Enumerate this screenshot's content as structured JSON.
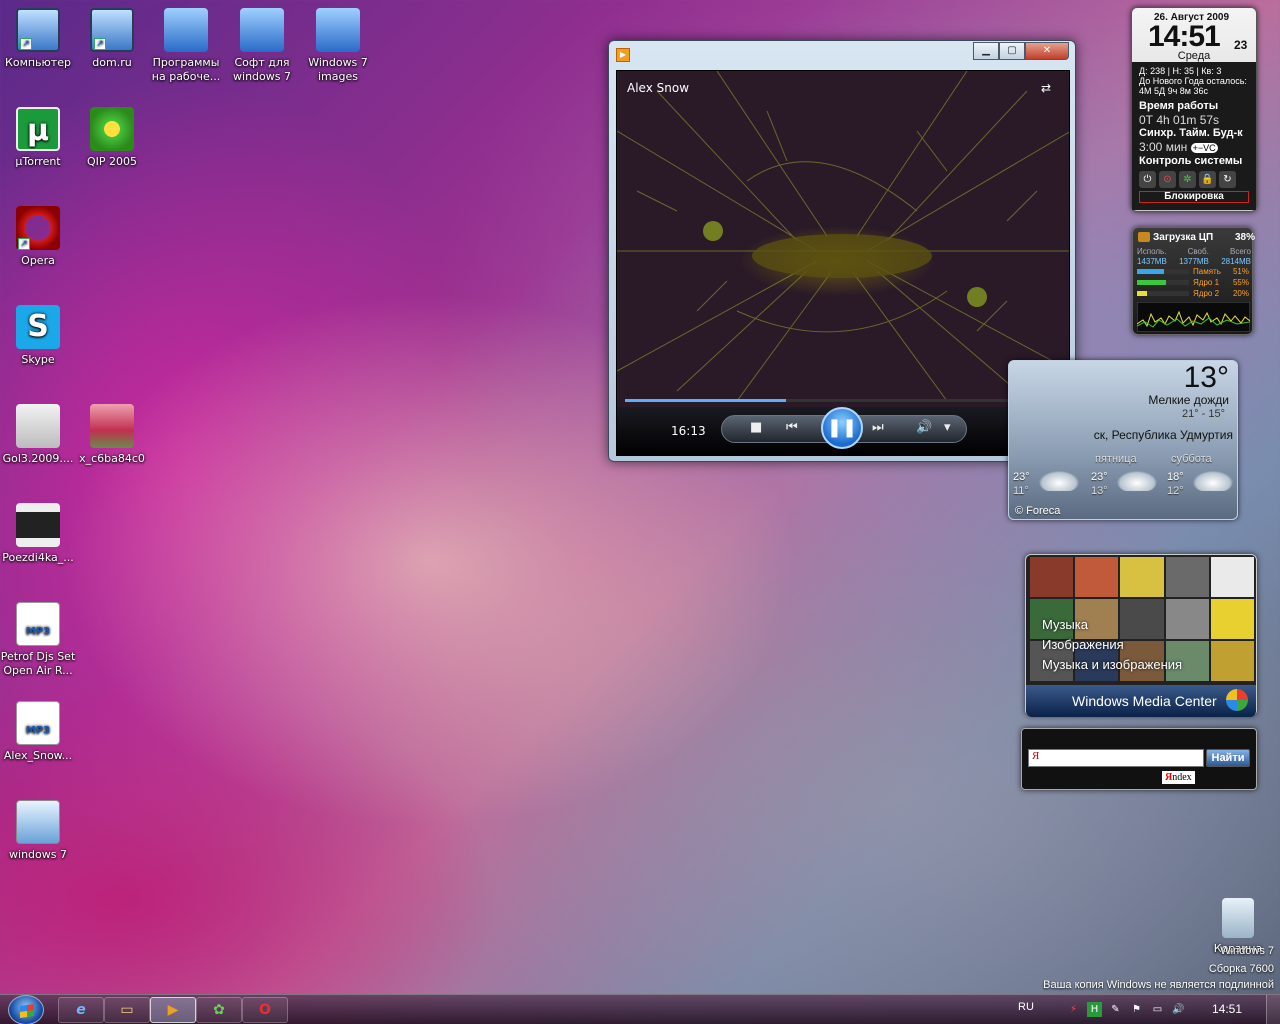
{
  "desktop_icons": [
    {
      "label": "Компьютер",
      "icon": "computer-icon"
    },
    {
      "label": "dom.ru",
      "icon": "computer-icon"
    },
    {
      "label": "Программы на рабоче...",
      "icon": "folder-icon"
    },
    {
      "label": "Софт для windows 7",
      "icon": "folder-icon"
    },
    {
      "label": "Windows 7 images",
      "icon": "folder-icon"
    },
    {
      "label": "µTorrent",
      "icon": "utorrent-icon"
    },
    {
      "label": "QIP 2005",
      "icon": "qip-icon"
    },
    {
      "label": "Opera",
      "icon": "opera-icon"
    },
    {
      "label": "Skype",
      "icon": "skype-icon"
    },
    {
      "label": "Gol3.2009....",
      "icon": "video-file-icon"
    },
    {
      "label": "x_c6ba84c0",
      "icon": "photo-icon"
    },
    {
      "label": "Poezdi4ka_...",
      "icon": "video-file-icon"
    },
    {
      "label": "Petrof Djs Set Open Air R...",
      "icon": "mp3-file-icon"
    },
    {
      "label": "Alex_Snow...",
      "icon": "mp3-file-icon"
    },
    {
      "label": "windows 7",
      "icon": "screenshot-icon"
    },
    {
      "label": "Корзина",
      "icon": "recycle-bin-icon"
    }
  ],
  "icon_glyphs": {
    "mp3": "MP3",
    "utorrent": "µ",
    "skype": "S",
    "shortcut": "↗"
  },
  "media_player": {
    "track": "Alex Snow",
    "time": "16:13",
    "progress": 0.37,
    "buttons": {
      "minimize": "▁",
      "maximize": "▢",
      "close": "✕",
      "stop": "■",
      "prev": "⏮",
      "pause": "❚❚",
      "next": "⏭",
      "volume": "🔊",
      "volume_menu": "▾",
      "switch_view": "⇄",
      "fullscreen": "⤢"
    },
    "icon": "▶"
  },
  "clock_gadget": {
    "date": "26. Август 2009",
    "hm": "14:51",
    "seconds": "23",
    "weekday": "Среда",
    "line1": "Д: 238 | Н: 35 | Кв: 3",
    "line2": "До Нового Года осталось:",
    "line3": "4М 5Д 9ч 8м 36с",
    "uptime_label": "Время работы",
    "uptime": "0Т 4h 01m 57s",
    "timer_label": "Синхр. Тайм. Буд-к",
    "timer": "3:00 мин",
    "timer_ctrl": "+−VC",
    "control_label": "Контроль системы",
    "system_buttons": [
      "⏻",
      "⊙",
      "✲",
      "🔒",
      "↻"
    ],
    "lock_label": "Блокировка"
  },
  "cpu_gadget": {
    "title": "Загрузка ЦП",
    "load": "38%",
    "cols": [
      "Исполь.",
      "Своб.",
      "Всего"
    ],
    "values": [
      "1437MB",
      "1377MB",
      "2814MB"
    ],
    "rows": [
      {
        "label": "Память",
        "pct": "51%",
        "fill": 0.51,
        "color": "#3aa8e8"
      },
      {
        "label": "Ядро 1",
        "pct": "55%",
        "fill": 0.55,
        "color": "#3ac83a"
      },
      {
        "label": "Ядро 2",
        "pct": "20%",
        "fill": 0.2,
        "color": "#e8e030"
      }
    ]
  },
  "weather_gadget": {
    "temp": "13°",
    "condition": "Мелкие дожди",
    "range": "21° - 15°",
    "city": "ск, Республика Удмуртия",
    "forecast": [
      {
        "day": "",
        "hi": "23°",
        "lo": "11°"
      },
      {
        "day": "пятница",
        "hi": "23°",
        "lo": "13°"
      },
      {
        "day": "суббота",
        "hi": "18°",
        "lo": "12°"
      }
    ],
    "provider": "© Foreca"
  },
  "media_center_gadget": {
    "menu": [
      "Музыка",
      "Изображения",
      "Музыка и изображения"
    ],
    "title": "Windows Media Center"
  },
  "yandex_gadget": {
    "input_value": "Я",
    "button": "Найти",
    "logo_first": "Я",
    "logo_rest": "ndex"
  },
  "watermark": {
    "line1": "Windows 7",
    "line2": "Сборка 7600",
    "line3": "Ваша копия Windows не является подлинной"
  },
  "taskbar": {
    "buttons": [
      {
        "name": "ie",
        "glyph": "e"
      },
      {
        "name": "explorer",
        "glyph": "▭"
      },
      {
        "name": "media-player",
        "glyph": "▶"
      },
      {
        "name": "qip",
        "glyph": "✿"
      },
      {
        "name": "opera",
        "glyph": "O"
      }
    ],
    "lang": "RU",
    "tray": [
      "⚡",
      "H",
      "✎",
      "⚑",
      "▭",
      "🔊"
    ],
    "clock": "14:51"
  }
}
